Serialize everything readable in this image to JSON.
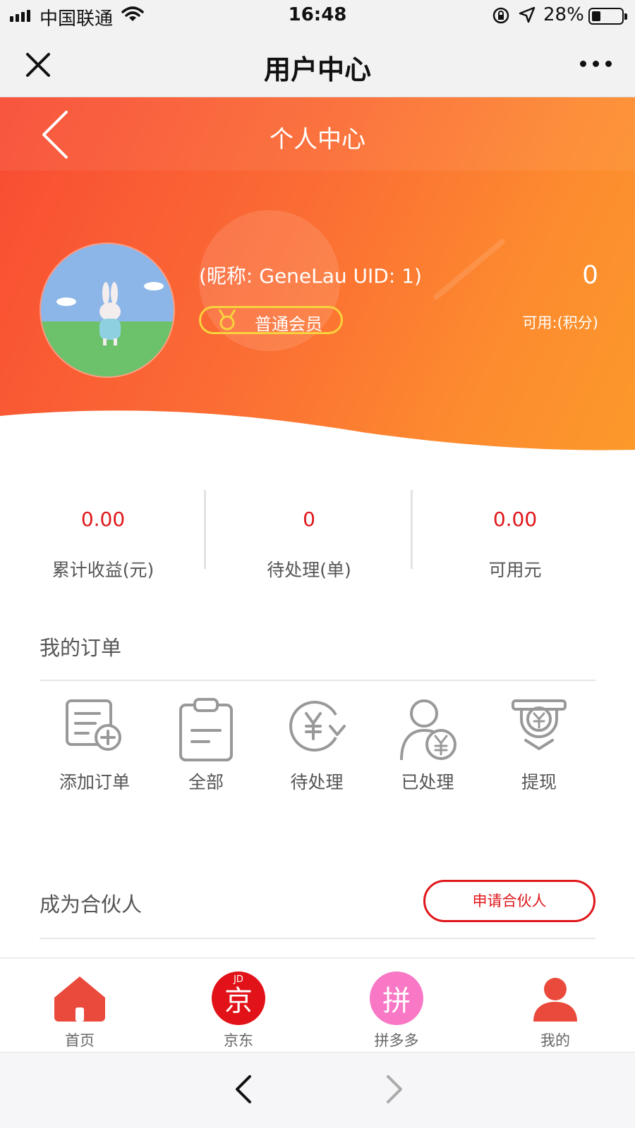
{
  "status_bar": {
    "carrier": "中国联通",
    "time": "16:48",
    "battery": "28%",
    "battery_level": 0.28
  },
  "wechat_nav": {
    "title": "用户中心"
  },
  "page_header": {
    "title": "个人中心"
  },
  "profile": {
    "nickname_line": "(昵称: GeneLau UID: 1)",
    "membership": "普通会员",
    "points_value": "0",
    "points_label": "可用:(积分)"
  },
  "stats": [
    {
      "value": "0.00",
      "label": "累计收益(元)"
    },
    {
      "value": "0",
      "label": "待处理(单)"
    },
    {
      "value": "0.00",
      "label": "可用元"
    }
  ],
  "orders": {
    "title": "我的订单",
    "items": [
      {
        "label": "添加订单",
        "icon": "add-order-icon"
      },
      {
        "label": "全部",
        "icon": "clipboard-icon"
      },
      {
        "label": "待处理",
        "icon": "pending-yuan-icon"
      },
      {
        "label": "已处理",
        "icon": "user-yuan-icon"
      },
      {
        "label": "提现",
        "icon": "withdraw-icon"
      }
    ]
  },
  "partner": {
    "title": "成为合伙人",
    "apply_label": "申请合伙人"
  },
  "tabbar": [
    {
      "label": "首页",
      "icon": "home-icon"
    },
    {
      "label": "京东",
      "icon": "jd-icon",
      "glyph": "京",
      "sub": "JD"
    },
    {
      "label": "拼多多",
      "icon": "pinduoduo-icon",
      "glyph": "拼"
    },
    {
      "label": "我的",
      "icon": "person-icon"
    }
  ],
  "colors": {
    "accent_red": "#e0171b",
    "header_orange": "#fb6d34",
    "badge_yellow": "#f7d33d",
    "pdd_pink": "#f878c6"
  }
}
